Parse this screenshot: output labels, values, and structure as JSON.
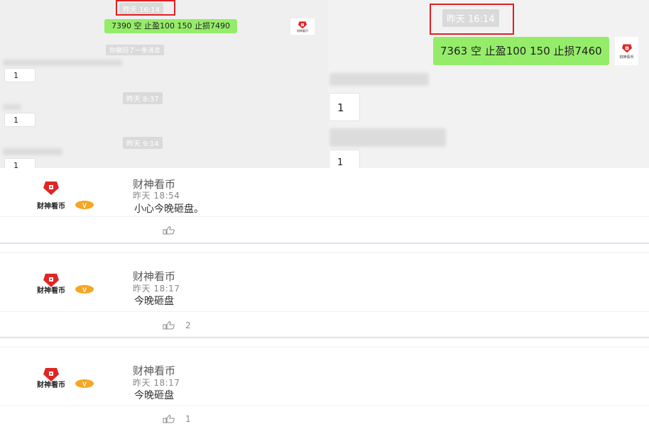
{
  "chat_left": {
    "timestamp_top": "昨天 16:14",
    "message_1": "7390   空   止盈100    150    止损7490",
    "system_notice": "你撤回了一条消息",
    "reply_1": "1",
    "timestamp_2": "昨天 8:37",
    "reply_2": "1",
    "timestamp_3": "昨天 9:14",
    "reply_3": "1",
    "logo_text": "财神看币"
  },
  "chat_right": {
    "timestamp": "昨天 16:14",
    "message": "7363  空   止盈100    150    止损7460",
    "reply_1": "1",
    "reply_2": "1",
    "logo_text": "财神看币"
  },
  "comments": [
    {
      "name": "财神看币",
      "time": "昨天 18:54",
      "text": "小心今晚砸盘。",
      "likes": ""
    },
    {
      "name": "财神看币",
      "time": "昨天 18:17",
      "text": "今晚砸盘",
      "likes": "2"
    },
    {
      "name": "财神看币",
      "time": "昨天 18:17",
      "text": "今晚砸盘",
      "likes": "1"
    }
  ],
  "avatar_text": "财神看币",
  "colors": {
    "brand_red": "#e02525",
    "vip_orange": "#f5a623",
    "bubble_green": "#95ec69",
    "highlight_red": "#e02020"
  },
  "icons": {
    "like": "thumbs-up-icon",
    "logo": "caishen-logo-icon",
    "vip": "vip-badge-icon"
  }
}
